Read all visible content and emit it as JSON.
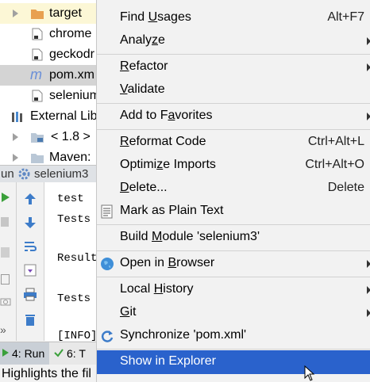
{
  "tree": {
    "items": [
      {
        "label": "target"
      },
      {
        "label": "chrome"
      },
      {
        "label": "geckodr"
      },
      {
        "label": "pom.xm"
      },
      {
        "label": "selenium"
      },
      {
        "label": "External Lib"
      },
      {
        "label": "< 1.8 >"
      },
      {
        "label": "Maven:"
      }
    ]
  },
  "run": {
    "tab_prefix": "un",
    "config_name": "selenium3",
    "console": [
      "test",
      "Tests",
      "Result",
      "Tests",
      "[INFO]"
    ]
  },
  "bottom": {
    "run_tab": "4: Run",
    "todo_tab": "6: T"
  },
  "status_text": "Highlights the fil",
  "menu": {
    "find_usages": {
      "pre": "Find ",
      "ul": "U",
      "post": "sages",
      "shortcut": "Alt+F7"
    },
    "analyze": {
      "pre": "Analy",
      "ul": "z",
      "post": "e"
    },
    "refactor": {
      "pre": "",
      "ul": "R",
      "post": "efactor"
    },
    "validate": {
      "pre": "",
      "ul": "V",
      "post": "alidate"
    },
    "add_favorites": {
      "pre": "Add to F",
      "ul": "a",
      "post": "vorites"
    },
    "reformat": {
      "pre": "",
      "ul": "R",
      "post": "eformat Code",
      "shortcut": "Ctrl+Alt+L"
    },
    "optimize": {
      "pre": "Optimi",
      "ul": "z",
      "post": "e Imports",
      "shortcut": "Ctrl+Alt+O"
    },
    "delete": {
      "pre": "",
      "ul": "D",
      "post": "elete...",
      "shortcut": "Delete"
    },
    "mark_plain": {
      "label": "Mark as Plain Text"
    },
    "build_module": {
      "pre": "Build ",
      "ul": "M",
      "post": "odule 'selenium3'"
    },
    "open_browser": {
      "pre": "Open in ",
      "ul": "B",
      "post": "rowser"
    },
    "local_history": {
      "pre": "Local ",
      "ul": "H",
      "post": "istory"
    },
    "git": {
      "pre": "",
      "ul": "G",
      "post": "it"
    },
    "synchronize": {
      "label": "Synchronize 'pom.xml'"
    },
    "show_explorer": {
      "label": "Show in Explorer"
    }
  },
  "colors": {
    "selection": "#2a62cc",
    "folder": "#e8a050",
    "maven_m": "#6a8fd8"
  }
}
